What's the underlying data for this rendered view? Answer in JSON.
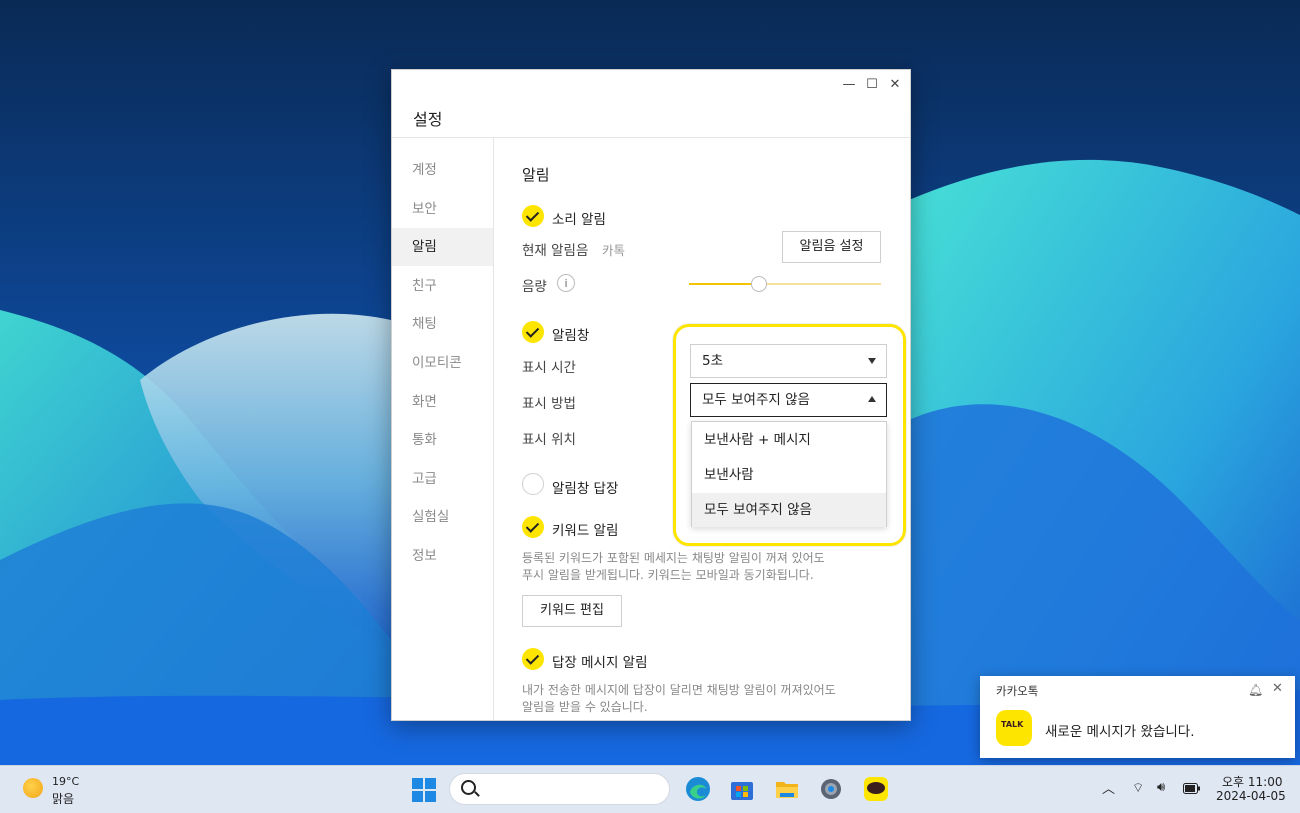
{
  "window": {
    "title": "설정",
    "controls": {
      "minimize": "—",
      "maximize": "☐",
      "close": "✕"
    }
  },
  "sidebar": {
    "items": [
      {
        "label": "계정"
      },
      {
        "label": "보안"
      },
      {
        "label": "알림",
        "active": true
      },
      {
        "label": "친구"
      },
      {
        "label": "채팅"
      },
      {
        "label": "이모티콘"
      },
      {
        "label": "화면"
      },
      {
        "label": "통화"
      },
      {
        "label": "고급"
      },
      {
        "label": "실험실"
      },
      {
        "label": "정보"
      }
    ]
  },
  "notifications": {
    "section_title": "알림",
    "sound": {
      "label": "소리 알림",
      "checked": true
    },
    "current_sound_label": "현재 알림음",
    "current_sound_value": "카톡",
    "sound_settings_button": "알림음 설정",
    "volume_label": "음량",
    "volume_info_icon": "i",
    "volume_level": 0.36,
    "popup": {
      "label": "알림창",
      "checked": true
    },
    "display_time_label": "표시 시간",
    "display_time_value": "5초",
    "display_method_label": "표시 방법",
    "display_method_value": "모두 보여주지 않음",
    "display_method_options": [
      "보낸사람 + 메시지",
      "보낸사람",
      "모두 보여주지 않음"
    ],
    "display_position_label": "표시 위치",
    "popup_reply": {
      "label": "알림창 답장",
      "checked": false
    },
    "keyword": {
      "label": "키워드 알림",
      "checked": true
    },
    "keyword_desc_line1": "등록된 키워드가 포함된 메세지는 채팅방 알림이 꺼져 있어도",
    "keyword_desc_line2": "푸시 알림을 받게됩니다. 키워드는 모바일과 동기화됩니다.",
    "keyword_edit_button": "키워드 편집",
    "reply_msg": {
      "label": "답장 메시지 알림",
      "checked": true
    },
    "reply_desc_line1": "내가 전송한 메시지에 답장이 달리면 채팅방 알림이 꺼져있어도",
    "reply_desc_line2": "알림을 받을 수 있습니다."
  },
  "toast": {
    "app": "카카오톡",
    "icon_text": "TALK",
    "message": "새로운 메시지가 왔습니다."
  },
  "taskbar": {
    "weather_temp": "19°C",
    "weather_desc": "맑음",
    "clock_time": "오후 11:00",
    "clock_date": "2024-04-05",
    "apps": [
      "edge-icon",
      "store-icon",
      "file-explorer-icon",
      "settings-icon",
      "kakaotalk-icon"
    ]
  },
  "colors": {
    "accent": "#fee500",
    "highlight": "#fee500"
  }
}
